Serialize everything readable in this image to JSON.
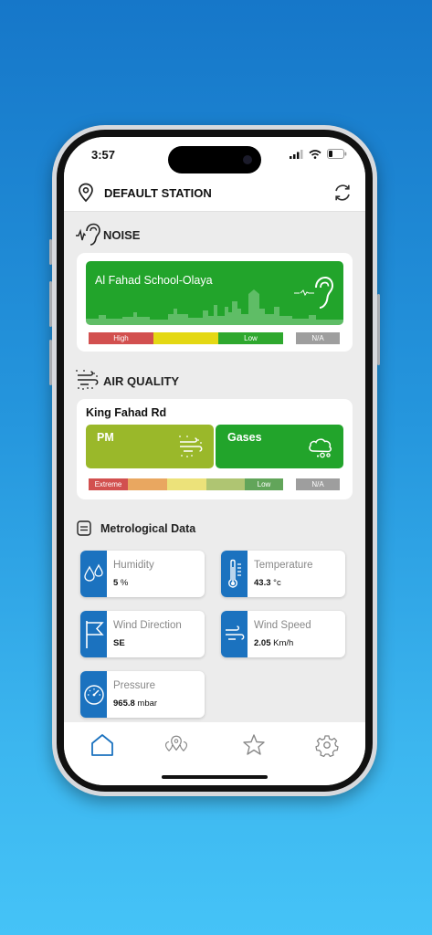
{
  "status": {
    "time": "3:57"
  },
  "header": {
    "title": "DEFAULT STATION",
    "pin_icon": "location-pin-icon",
    "refresh_icon": "refresh-icon"
  },
  "noise": {
    "title": "NOISE",
    "icon": "ear-wave-icon",
    "station": "Al Fahad School-Olaya",
    "tile_color": "#22a42b",
    "scale": {
      "high": "High",
      "low": "Low",
      "na": "N/A"
    },
    "scale_colors": [
      "#d2504f",
      "#e4d814",
      "#2ea82e",
      "#9e9e9e"
    ]
  },
  "air_quality": {
    "title": "AIR QUALITY",
    "icon": "air-particles-icon",
    "station": "King Fahad Rd",
    "pm": {
      "label": "PM",
      "color": "#9ab82a"
    },
    "gases": {
      "label": "Gases",
      "color": "#22a42b"
    },
    "scale": {
      "extreme": "Extreme",
      "low": "Low",
      "na": "N/A"
    },
    "scale_colors": [
      "#d2504f",
      "#e9a760",
      "#ece27a",
      "#afc572",
      "#62a55a",
      "#9e9e9e"
    ]
  },
  "met": {
    "title": "Metrological Data",
    "icon": "weather-station-icon",
    "accent": "#1b72bf",
    "items": {
      "humidity": {
        "label": "Humidity",
        "value": "5",
        "unit": " %"
      },
      "temperature": {
        "label": "Temperature",
        "value": "43.3",
        "unit": " °c"
      },
      "wind_direction": {
        "label": "Wind Direction",
        "value": "SE",
        "unit": ""
      },
      "wind_speed": {
        "label": "Wind Speed",
        "value": "2.05",
        "unit": " Km/h"
      },
      "pressure": {
        "label": "Pressure",
        "value": "965.8",
        "unit": " mbar"
      }
    }
  },
  "tabs": {
    "home": "home-icon",
    "stations": "stations-map-icon",
    "favorites": "star-icon",
    "settings": "gear-icon"
  },
  "accent_color": "#1b72bf"
}
